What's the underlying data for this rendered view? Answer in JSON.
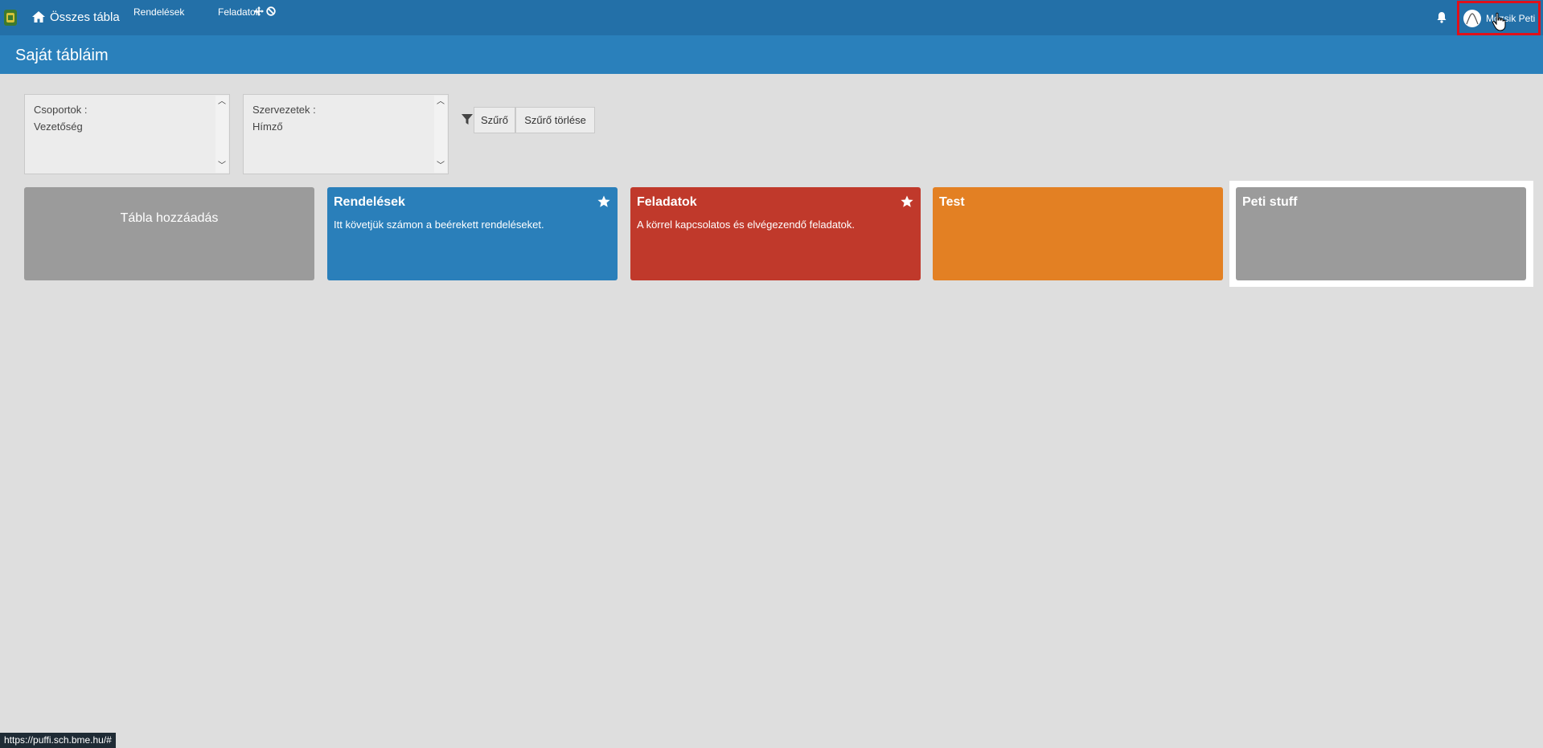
{
  "topbar": {
    "home_label": "Összes tábla",
    "nav_links": [
      "Rendelések",
      "Feladatok"
    ],
    "user_name": "Mozsik Peti",
    "colors": {
      "bar": "#2370a8",
      "highlight": "#e0101a"
    }
  },
  "header": {
    "title": "Saját tábláim"
  },
  "filters": {
    "groups_label": "Csoportok :",
    "groups_value": "Vezetőség",
    "orgs_label": "Szervezetek :",
    "orgs_value": "Hímző",
    "filter_button": "Szűrő",
    "clear_button": "Szűrő törlése"
  },
  "boards": {
    "add_label": "Tábla hozzáadás",
    "items": [
      {
        "title": "Rendelések",
        "description": "Itt követjük számon a beérekett rendeléseket.",
        "color": "#2a7fba",
        "starred": true
      },
      {
        "title": "Feladatok",
        "description": "A körrel kapcsolatos és elvégezendő feladatok.",
        "color": "#c0392b",
        "starred": true
      },
      {
        "title": "Test",
        "description": "",
        "color": "#e38023",
        "starred": false
      },
      {
        "title": "Peti stuff",
        "description": "",
        "color": "#9b9b9b",
        "starred": false
      }
    ]
  },
  "status_url": "https://puffi.sch.bme.hu/#"
}
